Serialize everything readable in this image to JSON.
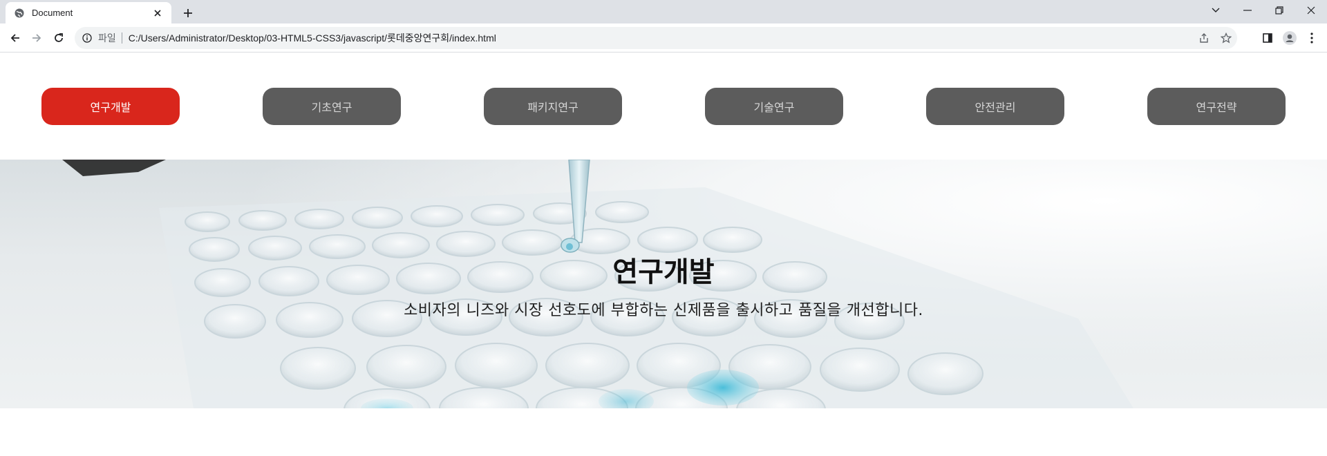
{
  "browser": {
    "tab": {
      "title": "Document",
      "favicon": "globe-icon"
    },
    "new_tab_icon": "plus-icon",
    "window_controls": [
      "chevron-down-icon",
      "minimize-icon",
      "restore-icon",
      "close-icon"
    ],
    "omnibox": {
      "scheme_label": "파일",
      "url": "C:/Users/Administrator/Desktop/03-HTML5-CSS3/javascript/롯데중앙연구회/index.html"
    }
  },
  "page": {
    "menu": {
      "items": [
        {
          "label": "연구개발",
          "active": true
        },
        {
          "label": "기초연구",
          "active": false
        },
        {
          "label": "패키지연구",
          "active": false
        },
        {
          "label": "기술연구",
          "active": false
        },
        {
          "label": "안전관리",
          "active": false
        },
        {
          "label": "연구전략",
          "active": false
        }
      ]
    },
    "hero": {
      "title": "연구개발",
      "subtitle": "소비자의 니즈와 시장 선호도에 부합하는 신제품을 출시하고 품질을 개선합니다."
    }
  },
  "colors": {
    "active_button": "#d9261c",
    "inactive_button": "#5c5c5c",
    "inactive_text": "#d6d6d6"
  }
}
